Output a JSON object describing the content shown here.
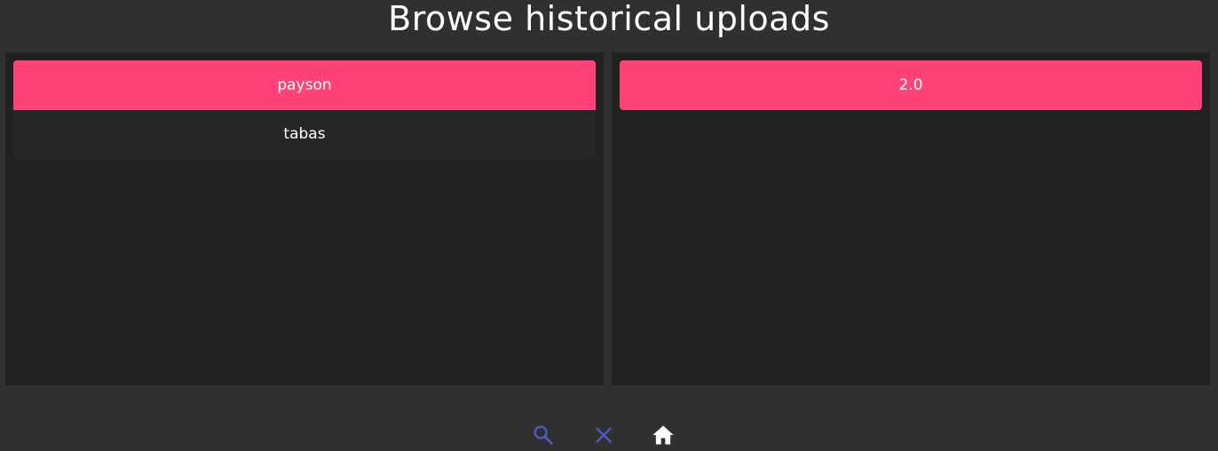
{
  "header": {
    "title": "Browse historical uploads"
  },
  "left_panel": {
    "items": [
      {
        "label": "payson",
        "selected": true
      },
      {
        "label": "tabas",
        "selected": false
      }
    ]
  },
  "right_panel": {
    "items": [
      {
        "label": "2.0",
        "selected": true
      }
    ]
  },
  "toolbar": {
    "icons": [
      "search-icon",
      "close-icon",
      "home-icon"
    ]
  },
  "colors": {
    "background": "#303030",
    "panel": "#212121",
    "accent": "#ff4379",
    "icon_blue": "#5059c9",
    "text": "#ffffff"
  }
}
